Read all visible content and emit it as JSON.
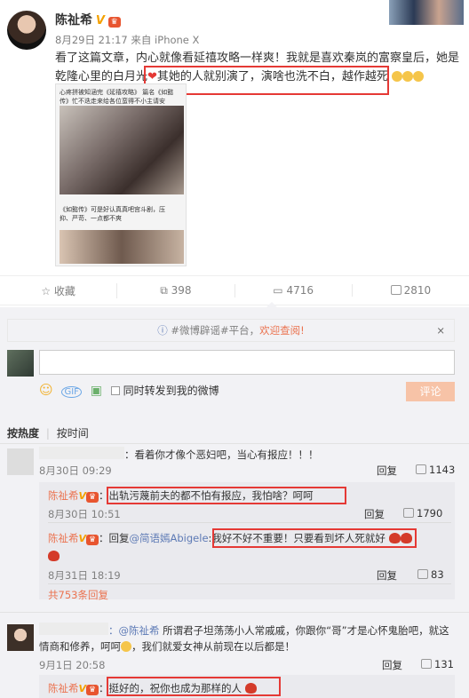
{
  "post": {
    "author": "陈祉希",
    "date": "8月29日 21:17",
    "source": "来自 iPhone X",
    "text_line1": "看了这篇文章，内心就像看延禧攻略一样爽！我就是喜欢秦岚的富察皇后，她是",
    "text_line2a": "乾隆心里的白月光",
    "text_line2b": "其她的人就别演了，演啥也洗不白，越作越死",
    "thumb_caption1": "心疼拼被知涵完《延禧攻略》",
    "thumb_caption2": "篇名《如懿",
    "thumb_caption3": "传》忙不迭走来给各位蛮得不小主请安",
    "thumb_caption4": "《如懿传》可是好认真真吧宫斗剧，压",
    "thumb_caption5": "抑、严苛、一点都不爽"
  },
  "actions": {
    "favorite": "收藏",
    "repost": "398",
    "comment": "4716",
    "like": "2810"
  },
  "notice": {
    "prefix": "#微博辟谣#平台，",
    "link": "欢迎查阅!",
    "close": "×"
  },
  "compose": {
    "sync_label": "同时转发到我的微博",
    "submit": "评论"
  },
  "sort": {
    "hot": "按热度",
    "time": "按时间"
  },
  "comments": [
    {
      "text": "：看着你才像个恶妇吧，当心有报应！！！",
      "date": "8月30日 09:29",
      "reply": "回复",
      "likes": "1143"
    }
  ],
  "reply1": {
    "author": "陈祉希",
    "text": "：出轨污蔑前夫的都不怕有报应，我怕啥？呵呵",
    "date": "8月30日 10:51",
    "reply": "回复",
    "likes": "1790"
  },
  "reply2": {
    "author": "陈祉希",
    "prefix": "：回复",
    "mention": "@简语嫣Abigele",
    "text": ":我好不好不重要！只要看到坏人死就好",
    "date": "8月31日 18:19",
    "reply": "回复",
    "likes": "83"
  },
  "more_replies": "共753条回复",
  "comment2": {
    "mention": "：@陈祉希",
    "text1": "所谓君子坦荡荡小人常戚戚，你跟你“哥”才是心怀鬼胎吧，就这",
    "text2a": "情商和修养，呵呵",
    "text2b": "，我们就爱女神从前现在以后都是！",
    "date": "9月1日 20:58",
    "reply": "回复",
    "likes": "131"
  },
  "reply3": {
    "author": "陈祉希",
    "text": "：挺好的，祝你也成为那样的人"
  }
}
